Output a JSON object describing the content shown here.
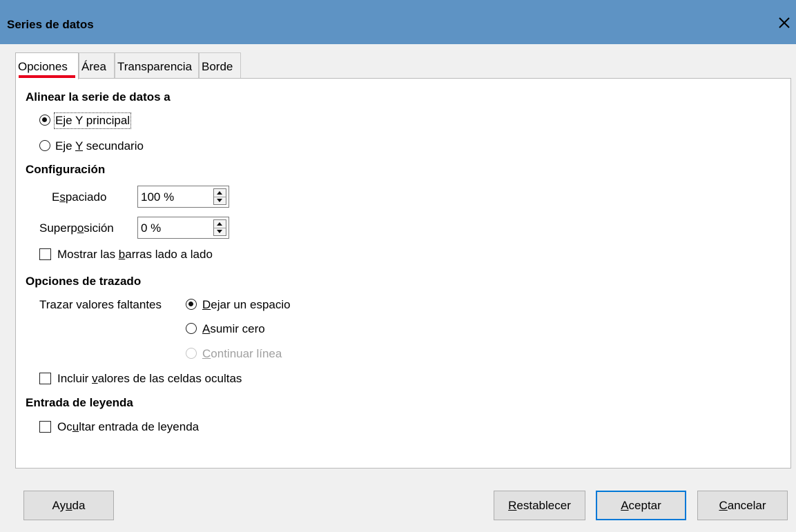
{
  "window": {
    "title": "Series de datos"
  },
  "tabs": [
    {
      "label": "Opciones"
    },
    {
      "label": "Área"
    },
    {
      "label": "Transparencia"
    },
    {
      "label": "Borde"
    }
  ],
  "align_section": {
    "heading": "Alinear la serie de datos a",
    "primary_y": "Eje Y principal",
    "secondary_y": {
      "before": "Eje ",
      "key": "Y",
      "after": " secundario"
    }
  },
  "config_section": {
    "heading": "Configuración",
    "spacing": {
      "label_before": "E",
      "label_key": "s",
      "label_after": "paciado",
      "value": "100 %"
    },
    "overlap": {
      "label_before": "Superp",
      "label_key": "o",
      "label_after": "sición",
      "value": "0 %"
    },
    "side_by_side": {
      "before": "Mostrar las ",
      "key": "b",
      "after": "arras lado a lado",
      "checked": false
    }
  },
  "plot_section": {
    "heading": "Opciones de trazado",
    "missing_label": "Trazar valores faltantes",
    "leave_gap": {
      "key": "D",
      "after": "ejar un espacio",
      "checked": true
    },
    "assume_zero": {
      "key": "A",
      "after": "sumir cero",
      "checked": false
    },
    "continue_line": {
      "key": "C",
      "after": "ontinuar línea",
      "enabled": false
    },
    "hidden_cells": {
      "before": "Incluir ",
      "key": "v",
      "after": "alores de las celdas ocultas",
      "checked": false
    }
  },
  "legend_section": {
    "heading": "Entrada de leyenda",
    "hide_entry": {
      "before": "Oc",
      "key": "u",
      "after": "ltar entrada de leyenda",
      "checked": false
    }
  },
  "buttons": {
    "help": {
      "before": "Ay",
      "key": "u",
      "after": "da"
    },
    "reset": {
      "key": "R",
      "after": "establecer"
    },
    "ok": {
      "key": "A",
      "after": "ceptar"
    },
    "cancel": {
      "key": "C",
      "after": "ancelar"
    }
  }
}
